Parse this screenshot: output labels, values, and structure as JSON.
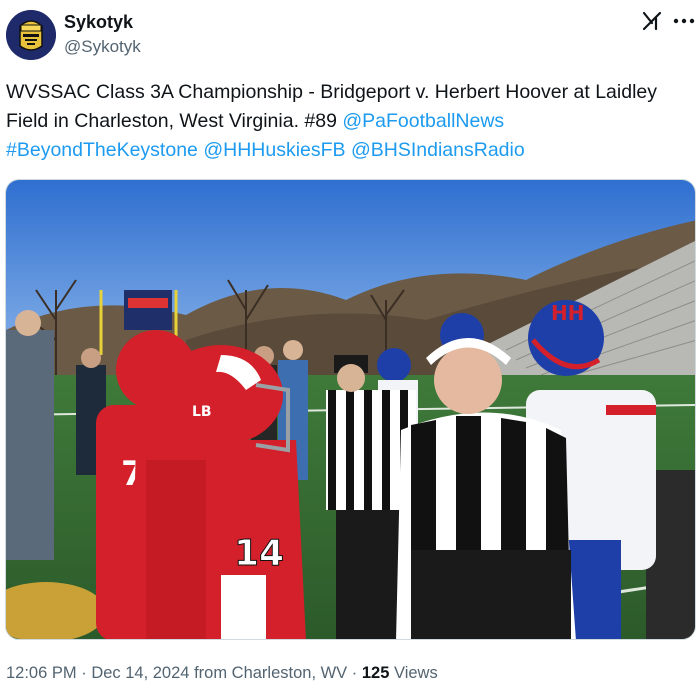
{
  "author": {
    "display_name": "Sykotyk",
    "handle": "@Sykotyk",
    "avatar_icon": "knight-helmet-avatar"
  },
  "header_icons": {
    "grok": "grok-icon",
    "more": "more-options-icon"
  },
  "tweet": {
    "text_plain": "WVSSAC Class 3A Championship - Bridgeport v. Herbert Hoover at Laidley Field in Charleston, West Virginia. #89",
    "mentions": [
      "@PaFootballNews",
      "#BeyondTheKeystone",
      "@HHHuskiesFB",
      "@BHSIndiansRadio"
    ]
  },
  "photo": {
    "player_numbers": [
      "7",
      "14"
    ],
    "helmet_text": "LB"
  },
  "meta": {
    "time": "12:06 PM",
    "separator": "·",
    "date": "Dec 14, 2024",
    "location": "from Charleston, WV",
    "views_count": "125",
    "views_label": "Views"
  },
  "colors": {
    "link": "#1d9bf0",
    "text": "#0f1419",
    "muted": "#536471",
    "bridgeport_red": "#d4202a",
    "hoover_blue": "#1f3fa8"
  }
}
